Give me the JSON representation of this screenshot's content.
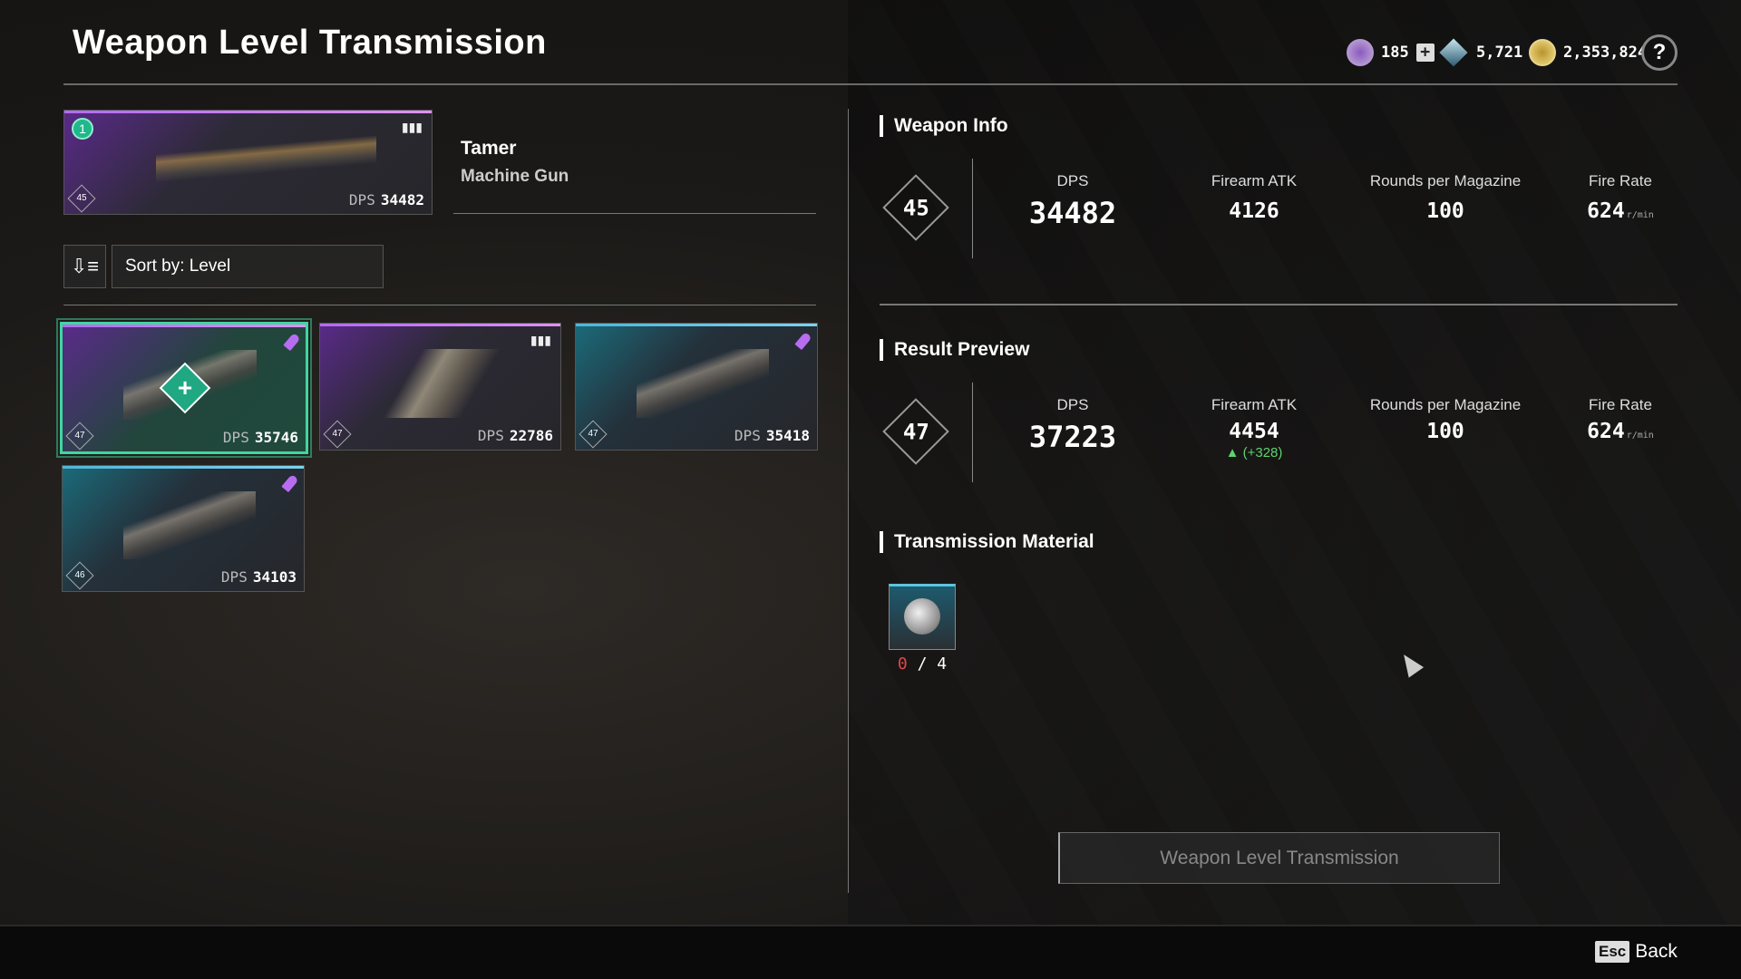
{
  "header": {
    "title": "Weapon Level Transmission",
    "currencies": [
      {
        "icon": "crystal-coin-icon",
        "value": "185"
      },
      {
        "icon": "kuiper-shard-icon",
        "value": "5,721"
      },
      {
        "icon": "gold-coin-icon",
        "value": "2,353,824"
      }
    ],
    "help_label": "?"
  },
  "current_weapon": {
    "name": "Tamer",
    "type": "Machine Gun",
    "level": "45",
    "dps_label": "DPS",
    "dps": "34482",
    "badge": "1"
  },
  "sort": {
    "label": "Sort by: Level"
  },
  "weapons": [
    {
      "level": "47",
      "dps": "35746",
      "selected": true,
      "rarity_color": "#9b59f0",
      "ammo": "special"
    },
    {
      "level": "47",
      "dps": "22786",
      "selected": false,
      "rarity_color": "#9b59f0",
      "ammo": "heavy"
    },
    {
      "level": "47",
      "dps": "35418",
      "selected": false,
      "rarity_color": "#4fb6d8",
      "ammo": "special"
    },
    {
      "level": "46",
      "dps": "34103",
      "selected": false,
      "rarity_color": "#4fb6d8",
      "ammo": "special"
    }
  ],
  "weapon_info": {
    "title": "Weapon Info",
    "level": "45",
    "stats": [
      {
        "label": "DPS",
        "value": "34482"
      },
      {
        "label": "Firearm ATK",
        "value": "4126"
      },
      {
        "label": "Rounds per Magazine",
        "value": "100"
      },
      {
        "label": "Fire Rate",
        "value": "624",
        "unit": "r/min"
      }
    ]
  },
  "result_preview": {
    "title": "Result Preview",
    "level": "47",
    "stats": [
      {
        "label": "DPS",
        "value": "37223"
      },
      {
        "label": "Firearm ATK",
        "value": "4454",
        "delta": "▲ (+328)"
      },
      {
        "label": "Rounds per Magazine",
        "value": "100"
      },
      {
        "label": "Fire Rate",
        "value": "624",
        "unit": "r/min"
      }
    ]
  },
  "material": {
    "title": "Transmission Material",
    "owned": "0",
    "required": "/ 4"
  },
  "action_button": "Weapon Level Transmission",
  "footer": {
    "key": "Esc",
    "label": "Back"
  },
  "colors": {
    "accent": "#3fd6a0",
    "positive": "#5ed36e",
    "insufficient": "#e04848"
  }
}
